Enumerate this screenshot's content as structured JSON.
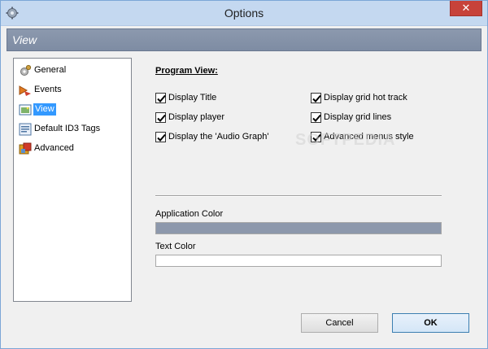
{
  "window": {
    "title": "Options",
    "close_label": "✕",
    "app_icon": "gear-icon"
  },
  "header": {
    "title": "View"
  },
  "sidebar": {
    "items": [
      {
        "label": "General",
        "icon": "gear-icon"
      },
      {
        "label": "Events",
        "icon": "events-icon"
      },
      {
        "label": "View",
        "icon": "view-icon",
        "selected": true
      },
      {
        "label": "Default ID3 Tags",
        "icon": "tags-icon"
      },
      {
        "label": "Advanced",
        "icon": "advanced-icon"
      }
    ]
  },
  "program_view": {
    "title": "Program View:",
    "options": [
      {
        "label": "Display Title",
        "checked": true
      },
      {
        "label": "Display player",
        "checked": true
      },
      {
        "label": "Display the 'Audio Graph'",
        "checked": true
      },
      {
        "label": "Display grid hot track",
        "checked": true
      },
      {
        "label": "Display grid lines",
        "checked": true
      },
      {
        "label": "Advanced menus style",
        "checked": true
      }
    ]
  },
  "colors": {
    "application_color_label": "Application Color",
    "application_color_value": "#8d98ac",
    "text_color_label": "Text Color",
    "text_color_value": "#ffffff"
  },
  "watermark": "SOFTPEDIA",
  "buttons": {
    "cancel": "Cancel",
    "ok": "OK"
  }
}
